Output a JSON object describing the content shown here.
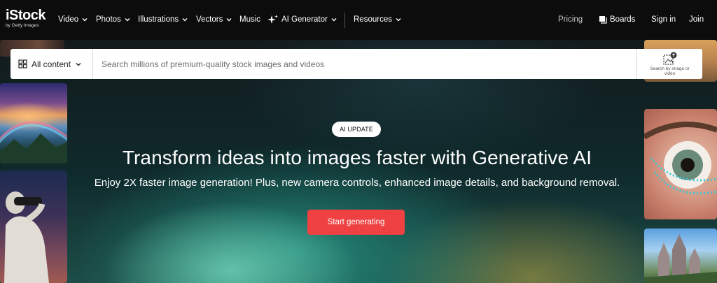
{
  "logo": {
    "main": "iStock",
    "sub": "by Getty Images"
  },
  "nav": {
    "items": [
      {
        "label": "Video",
        "dropdown": true
      },
      {
        "label": "Photos",
        "dropdown": true
      },
      {
        "label": "Illustrations",
        "dropdown": true
      },
      {
        "label": "Vectors",
        "dropdown": true
      },
      {
        "label": "Music",
        "dropdown": false
      },
      {
        "label": "AI Generator",
        "dropdown": true,
        "icon": "sparkle-icon"
      },
      {
        "label": "Resources",
        "dropdown": true
      }
    ],
    "pricing": "Pricing",
    "boards": "Boards",
    "signin": "Sign in",
    "join": "Join"
  },
  "search": {
    "content_filter": "All content",
    "placeholder": "Search millions of premium-quality stock images and videos",
    "image_search_label": "Search by image or video"
  },
  "hero": {
    "badge": "AI UPDATE",
    "headline": "Transform ideas into images faster with Generative AI",
    "subline": "Enjoy 2X faster image generation! Plus, new camera controls, enhanced image details, and background removal.",
    "cta": "Start generating"
  },
  "colors": {
    "nav_bg": "#0c0c0c",
    "cta": "#ef4141",
    "hero_teal": "#2aa896"
  },
  "icons": [
    "chevron-down-icon",
    "sparkle-icon",
    "boards-icon",
    "grid-icon",
    "image-search-icon"
  ]
}
